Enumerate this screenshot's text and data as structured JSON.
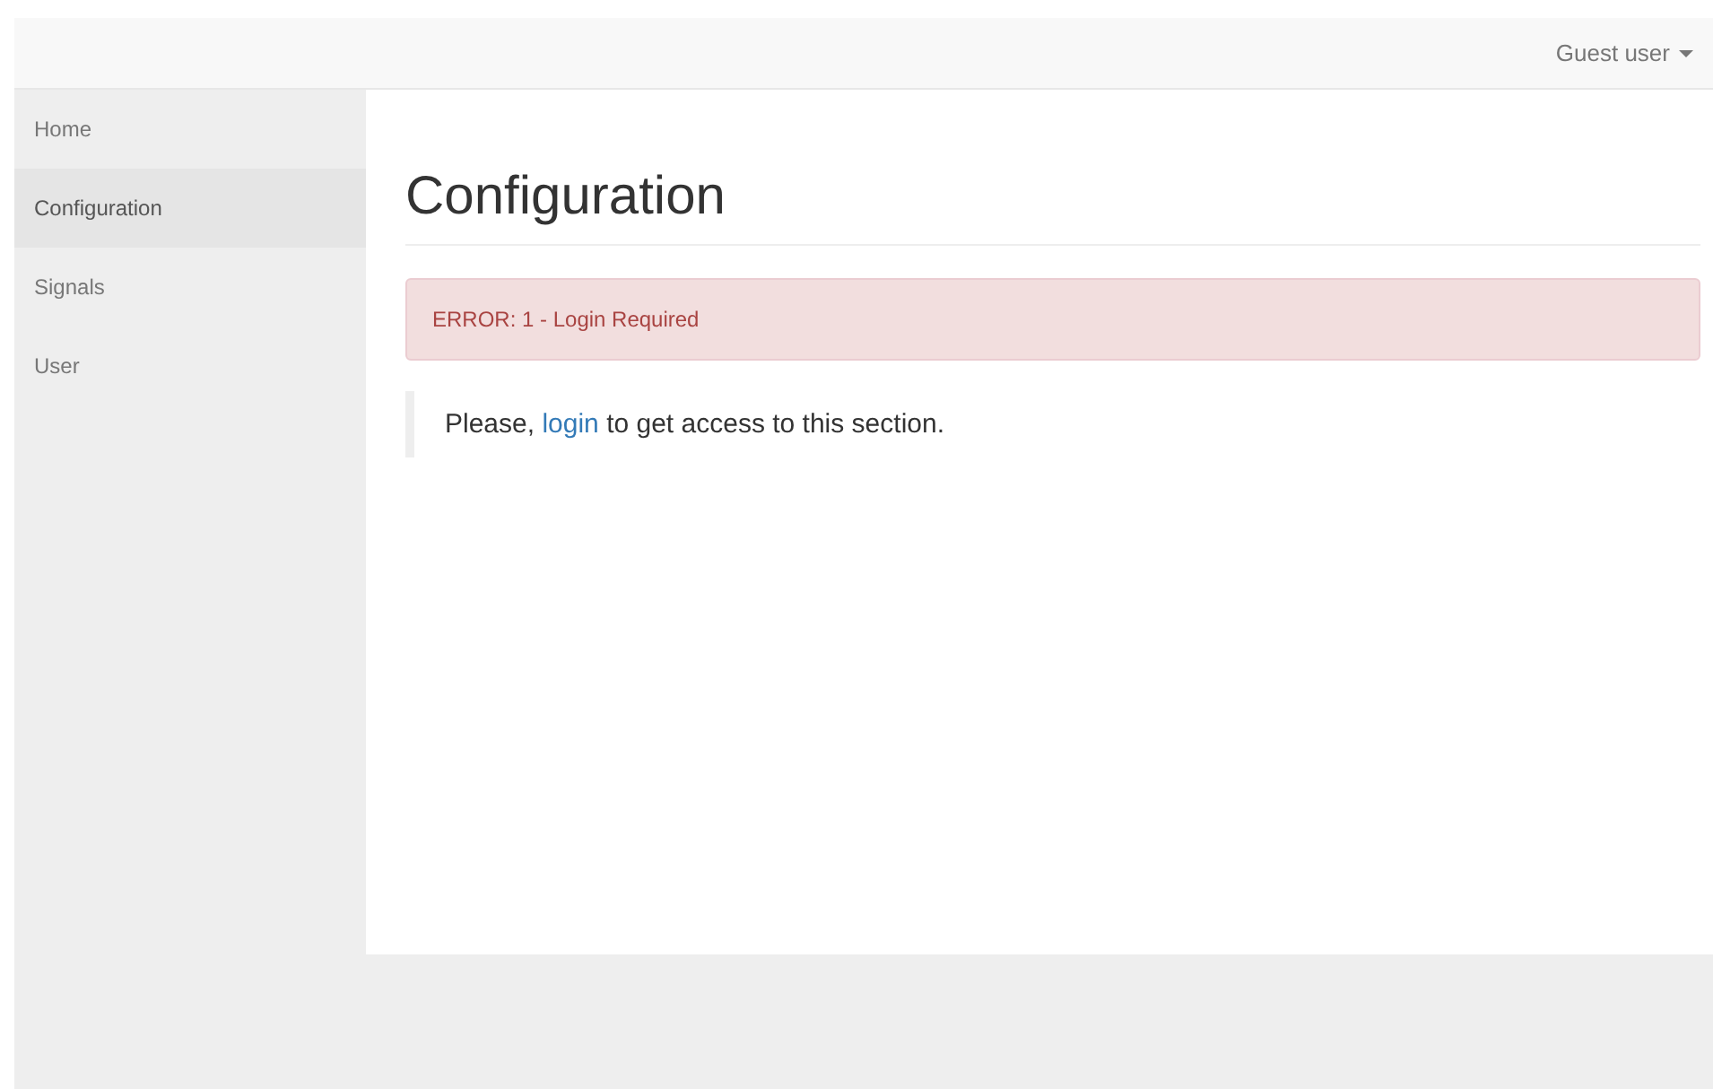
{
  "navbar": {
    "user_menu": "Guest user"
  },
  "sidebar": {
    "items": [
      {
        "label": "Home",
        "selected": false
      },
      {
        "label": "Configuration",
        "selected": true
      },
      {
        "label": "Signals",
        "selected": false
      },
      {
        "label": "User",
        "selected": false
      }
    ]
  },
  "main": {
    "title": "Configuration",
    "alert": "ERROR: 1 - Login Required",
    "message": {
      "before": "Please,",
      "link": "login",
      "after": "to get access to this section."
    }
  }
}
